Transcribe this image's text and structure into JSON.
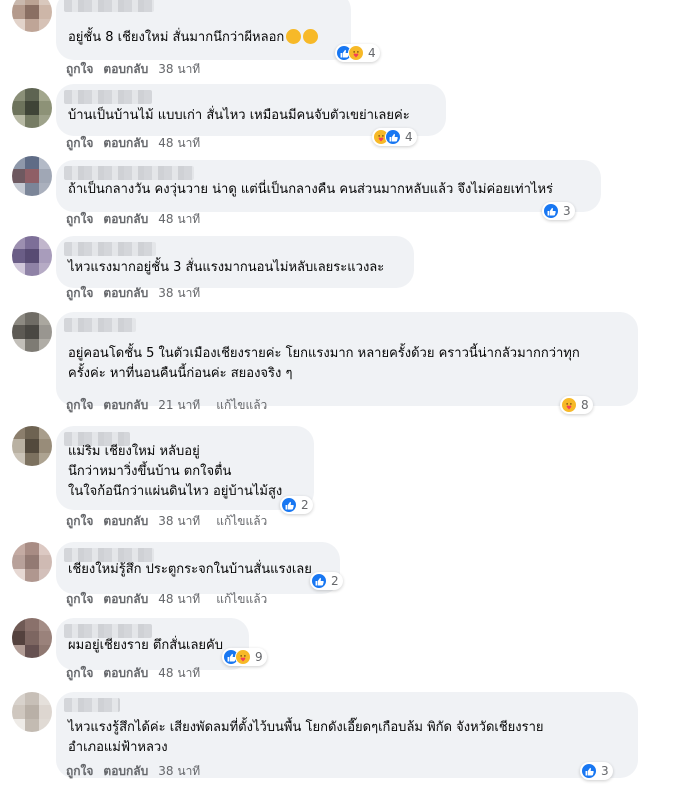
{
  "labels": {
    "like": "ถูกใจ",
    "reply": "ตอบกลับ",
    "edited": "แก้ไขแล้ว"
  },
  "colors": {
    "bubble": "#f0f2f5",
    "meta": "#65676b",
    "like": "#1877f2",
    "care": "#f7b928"
  },
  "comments": [
    {
      "lines": [
        "อยู่ชั้น 8 เชียงใหม่ สั่นมากนึกว่าผีหลอก"
      ],
      "emoji_suffix": [
        "grinning-sweat-emoji",
        "astonished-emoji"
      ],
      "reactions": [
        "like",
        "care"
      ],
      "count": "4",
      "time": "38 นาที",
      "edited": ""
    },
    {
      "lines": [
        "บ้านเป็นบ้านไม้ แบบเก่า สั่นไหว เหมือนมีคนจับตัวเขย่าเลยค่ะ"
      ],
      "reactions": [
        "care",
        "like"
      ],
      "count": "4",
      "time": "48 นาที",
      "edited": ""
    },
    {
      "lines": [
        "ถ้าเป็นกลางวัน คงวุ่นวาย น่าดู แต่นี่เป็นกลางคืน คนส่วนมากหลับแล้ว จึงไม่ค่อยเท่าไหร่"
      ],
      "reactions": [
        "like"
      ],
      "count": "3",
      "time": "48 นาที",
      "edited": ""
    },
    {
      "lines": [
        "ไหวแรงมากอยู่ชั้น 3 สั่นแรงมากนอนไม่หลับเลยระแวงละ"
      ],
      "reactions": [],
      "count": "",
      "time": "38 นาที",
      "edited": ""
    },
    {
      "lines": [
        "อยู่คอนโดชั้น 5 ในตัวเมืองเชียงรายค่ะ โยกแรงมาก หลายครั้งด้วย คราวนี้น่ากลัวมากกว่าทุก",
        "ครั้งค่ะ หาที่นอนคืนนี้ก่อนค่ะ สยองจริง ๆ"
      ],
      "reactions": [
        "care"
      ],
      "count": "8",
      "time": "21 นาที",
      "edited": "แก้ไขแล้ว"
    },
    {
      "lines": [
        "แม่ริม เชียงใหม่ หลับอยู่",
        "นึกว่าหมาวิ่งขึ้นบ้าน ตกใจตื่น",
        "ในใจก้อนึกว่าแผ่นดินไหว อยู่บ้านไม้สูง"
      ],
      "reactions": [
        "like"
      ],
      "count": "2",
      "time": "38 นาที",
      "edited": "แก้ไขแล้ว"
    },
    {
      "lines": [
        "เชียงใหม่รู้สึก ประตูกระจกในบ้านสั่นแรงเลย"
      ],
      "reactions": [
        "like"
      ],
      "count": "2",
      "time": "48 นาที",
      "edited": "แก้ไขแล้ว"
    },
    {
      "lines": [
        "ผมอยู่เชียงราย ตึกสั่นเลยคับ"
      ],
      "reactions": [
        "like",
        "care"
      ],
      "count": "9",
      "time": "48 นาที",
      "edited": ""
    },
    {
      "lines": [
        "ไหวแรงรู้สึกได้ค่ะ เสียงพัดลมที่ตั้งไว้บนพื้น โยกดังเอี๊ยดๆเกือบล้ม พิกัด จังหวัดเชียงราย",
        "อำเภอแม่ฟ้าหลวง"
      ],
      "reactions": [
        "like"
      ],
      "count": "3",
      "time": "38 นาที",
      "edited": ""
    }
  ]
}
